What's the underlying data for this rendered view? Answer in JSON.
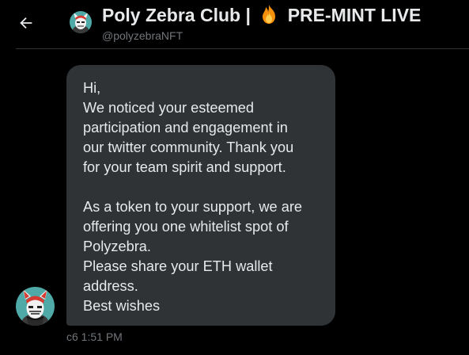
{
  "header": {
    "title_name": "Poly Zebra Club |",
    "title_suffix": "PRE-MINT LIVE",
    "title_icon": "fire-emoji",
    "handle": "@polyzebraNFT",
    "back_icon": "arrow-left-icon"
  },
  "message": {
    "lines": [
      "Hi,",
      "We noticed your esteemed",
      "participation and engagement in",
      "our twitter community. Thank you",
      "for your team spirit and support.",
      "",
      "As a token to your support, we are",
      "offering you one whitelist spot of",
      "Polyzebra.",
      "Please share your ETH wallet",
      "address.",
      "Best wishes"
    ],
    "timestamp": "c6 1:51 PM"
  },
  "colors": {
    "background": "#000000",
    "bubble": "#2f3336",
    "text": "#e7e9ea",
    "muted": "#71767b",
    "avatar_accent": "#d63b32",
    "avatar_bg": "#4fa9a6"
  }
}
